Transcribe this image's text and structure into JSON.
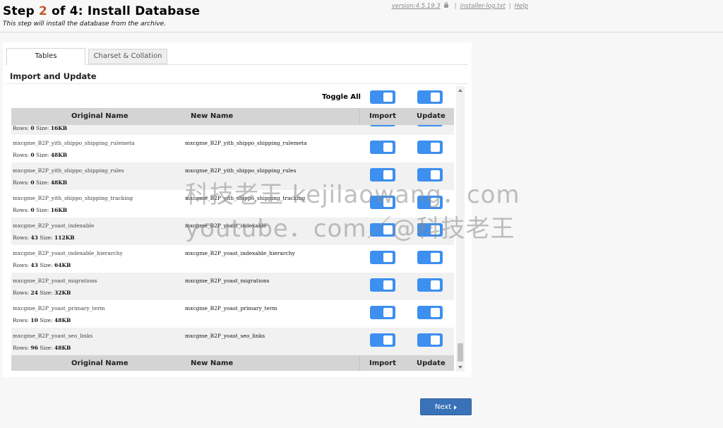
{
  "header": {
    "step_prefix": "Step ",
    "step_current": "2",
    "step_suffix": " of 4: Install Database",
    "subtitle": "This step will install the database from the archive.",
    "version": "version:4.5.19.3",
    "installer_log": "installer-log.txt",
    "help": "Help"
  },
  "tabs": [
    {
      "label": "Tables",
      "active": true
    },
    {
      "label": "Charset & Collation",
      "active": false
    }
  ],
  "section_title": "Import and Update",
  "toggle_all_label": "Toggle All",
  "table": {
    "columns": {
      "original": "Original Name",
      "new": "New Name",
      "import": "Import",
      "update": "Update"
    },
    "partial_row": {
      "rows_label": "Rows:",
      "rows": "0",
      "size_label": "Size:",
      "size": "16KB"
    },
    "rows": [
      {
        "original": "mxcgme_B2P_yith_shippo_shipping_rulemeta",
        "new": "mxcgme_B2P_yith_shippo_shipping_rulemeta",
        "rows": "0",
        "size": "48KB"
      },
      {
        "original": "mxcgme_B2P_yith_shippo_shipping_rules",
        "new": "mxcgme_B2P_yith_shippo_shipping_rules",
        "rows": "0",
        "size": "48KB"
      },
      {
        "original": "mxcgme_B2P_yith_shippo_shipping_tracking",
        "new": "mxcgme_B2P_yith_shippo_shipping_tracking",
        "rows": "0",
        "size": "16KB"
      },
      {
        "original": "mxcgme_B2P_yoast_indexable",
        "new": "mxcgme_B2P_yoast_indexable",
        "rows": "43",
        "size": "112KB"
      },
      {
        "original": "mxcgme_B2P_yoast_indexable_hierarchy",
        "new": "mxcgme_B2P_yoast_indexable_hierarchy",
        "rows": "43",
        "size": "64KB"
      },
      {
        "original": "mxcgme_B2P_yoast_migrations",
        "new": "mxcgme_B2P_yoast_migrations",
        "rows": "24",
        "size": "32KB"
      },
      {
        "original": "mxcgme_B2P_yoast_primary_term",
        "new": "mxcgme_B2P_yoast_primary_term",
        "rows": "10",
        "size": "48KB"
      },
      {
        "original": "mxcgme_B2P_yoast_seo_links",
        "new": "mxcgme_B2P_yoast_seo_links",
        "rows": "96",
        "size": "48KB"
      }
    ],
    "rows_label": "Rows:",
    "size_label": "Size:"
  },
  "watermark": {
    "line1": "科技老王 kejilaowang．com",
    "line2": "youtube．com／@科技老王"
  },
  "next_button": "Next",
  "colors": {
    "accent": "#3d8ff0",
    "step_number": "#c0582a",
    "next_button": "#3972b8"
  }
}
